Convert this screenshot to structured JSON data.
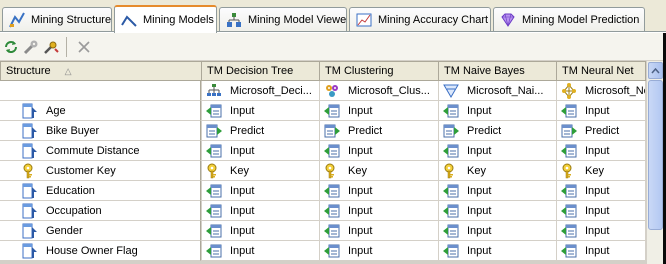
{
  "tabs": [
    {
      "label": "Mining Structure",
      "icon": "mining-structure-icon",
      "active": false
    },
    {
      "label": "Mining Models",
      "icon": "mining-models-icon",
      "active": true
    },
    {
      "label": "Mining Model Viewer",
      "icon": "model-viewer-icon",
      "active": false
    },
    {
      "label": "Mining Accuracy Chart",
      "icon": "accuracy-chart-icon",
      "active": false
    },
    {
      "label": "Mining Model Prediction",
      "icon": "prediction-diamond-icon",
      "active": false
    }
  ],
  "toolbar": {
    "buttons": [
      "refresh-icon",
      "process-icon",
      "related-icon",
      "delete-icon"
    ]
  },
  "grid": {
    "structure_header": "Structure",
    "sort_glyph": "△",
    "models": [
      {
        "name": "TM Decision Tree",
        "algorithm": "Microsoft_Deci...",
        "algorithm_icon": "decision-tree-icon"
      },
      {
        "name": "TM Clustering",
        "algorithm": "Microsoft_Clus...",
        "algorithm_icon": "clustering-icon"
      },
      {
        "name": "TM Naive Bayes",
        "algorithm": "Microsoft_Nai...",
        "algorithm_icon": "naive-bayes-icon"
      },
      {
        "name": "TM Neural Net",
        "algorithm": "Microsoft_Ne",
        "algorithm_icon": "neural-net-icon"
      }
    ],
    "rows": [
      {
        "column": "Age",
        "icon": "column-icon",
        "usage": [
          "Input",
          "Input",
          "Input",
          "Input"
        ]
      },
      {
        "column": "Bike Buyer",
        "icon": "column-icon",
        "usage": [
          "Predict",
          "Predict",
          "Predict",
          "Predict"
        ]
      },
      {
        "column": "Commute Distance",
        "icon": "column-icon",
        "usage": [
          "Input",
          "Input",
          "Input",
          "Input"
        ]
      },
      {
        "column": "Customer Key",
        "icon": "key-icon",
        "usage": [
          "Key",
          "Key",
          "Key",
          "Key"
        ]
      },
      {
        "column": "Education",
        "icon": "column-icon",
        "usage": [
          "Input",
          "Input",
          "Input",
          "Input"
        ]
      },
      {
        "column": "Occupation",
        "icon": "column-icon",
        "usage": [
          "Input",
          "Input",
          "Input",
          "Input"
        ]
      },
      {
        "column": "Gender",
        "icon": "column-icon",
        "usage": [
          "Input",
          "Input",
          "Input",
          "Input"
        ]
      },
      {
        "column": "House Owner Flag",
        "icon": "column-icon",
        "usage": [
          "Input",
          "Input",
          "Input",
          "Input"
        ]
      }
    ]
  },
  "colors": {
    "active_tab_accent": "#e68b2c",
    "grid_line": "#d4d0c8",
    "header_bg": "#ece9d8"
  }
}
